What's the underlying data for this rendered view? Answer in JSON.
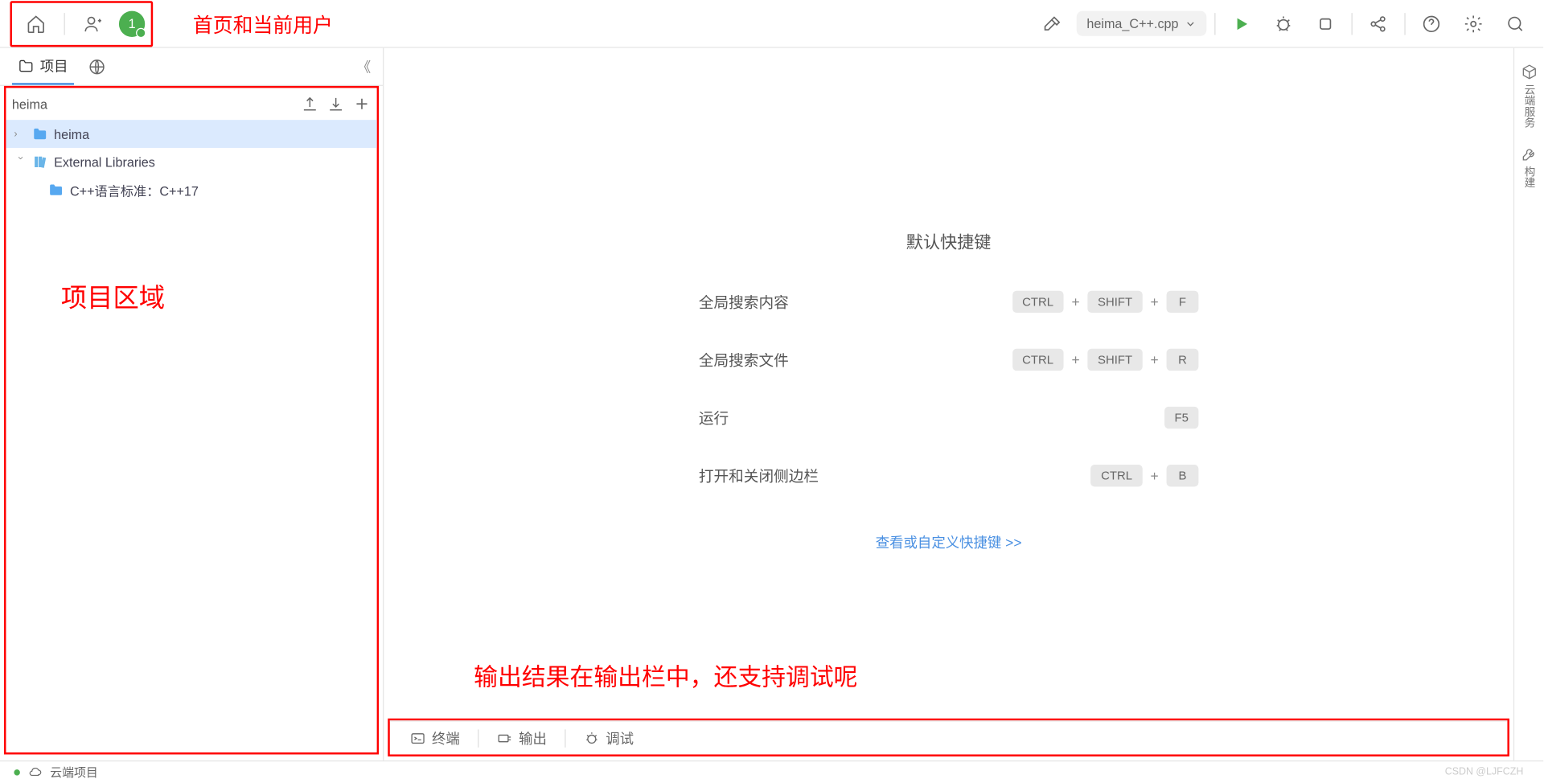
{
  "toolbar": {
    "avatar_number": "1",
    "annotation": "首页和当前用户",
    "file_dropdown": "heima_C++.cpp"
  },
  "sidebar": {
    "tabs": {
      "project": "项目"
    },
    "project_name": "heima",
    "tree": {
      "root": "heima",
      "lib": "External Libraries",
      "cpp_std": "C++语言标准：C++17"
    },
    "annotation": "项目区域"
  },
  "shortcuts": {
    "title": "默认快捷键",
    "rows": [
      {
        "label": "全局搜索内容",
        "keys": [
          "CTRL",
          "SHIFT",
          "F"
        ]
      },
      {
        "label": "全局搜索文件",
        "keys": [
          "CTRL",
          "SHIFT",
          "R"
        ]
      },
      {
        "label": "运行",
        "keys": [
          "F5"
        ]
      },
      {
        "label": "打开和关闭侧边栏",
        "keys": [
          "CTRL",
          "B"
        ]
      }
    ],
    "link": "查看或自定义快捷键 >>"
  },
  "editor_annotation": "输出结果在输出栏中，还支持调试呢",
  "bottom_tabs": {
    "terminal": "终端",
    "output": "输出",
    "debug": "调试"
  },
  "right_rail": {
    "cloud": "云端服务",
    "build": "构建"
  },
  "status": {
    "cloud_project": "云端项目"
  },
  "watermark": "CSDN @LJFCZH"
}
